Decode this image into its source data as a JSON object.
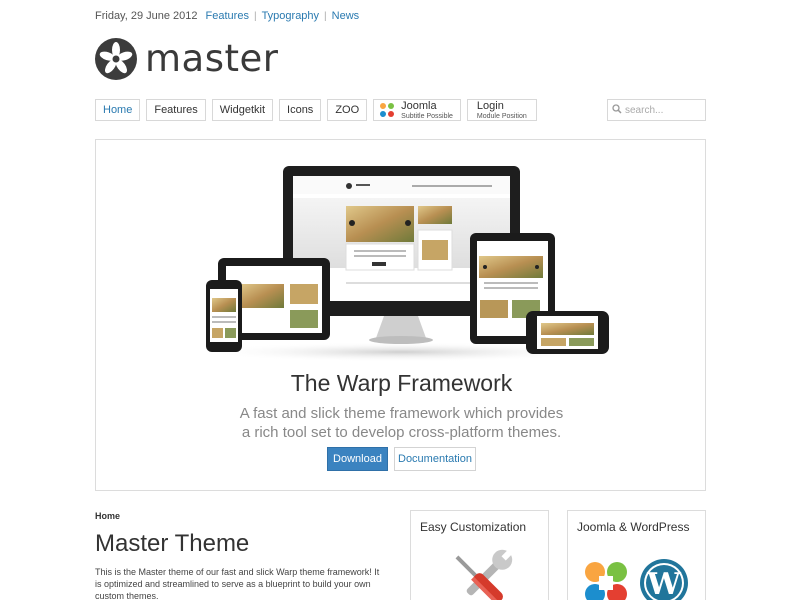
{
  "topbar": {
    "date": "Friday, 29 June 2012",
    "links": [
      "Features",
      "Typography",
      "News"
    ]
  },
  "logo": {
    "text": "master",
    "icon": "logo-flower-icon"
  },
  "nav": {
    "items": [
      {
        "label": "Home",
        "active": true
      },
      {
        "label": "Features"
      },
      {
        "label": "Widgetkit"
      },
      {
        "label": "Icons"
      },
      {
        "label": "ZOO"
      }
    ],
    "joomla": {
      "label": "Joomla",
      "subtitle": "Subtitle Possible",
      "icon": "joomla-icon"
    },
    "login": {
      "label": "Login",
      "subtitle": "Module Position"
    }
  },
  "search": {
    "placeholder": "search...",
    "icon": "search-icon"
  },
  "hero": {
    "title": "The Warp Framework",
    "subtitle_line1": "A fast and slick theme framework which provides",
    "subtitle_line2": "a rich tool set to develop cross-platform themes.",
    "primary_button": "Download",
    "secondary_button": "Documentation"
  },
  "content": {
    "breadcrumb": "Home",
    "title": "Master Theme",
    "intro_line1": "This is the Master theme of our fast and slick Warp theme framework! It",
    "intro_line2": "is optimized and streamlined to serve as a blueprint to build your own",
    "intro_line3": "custom themes."
  },
  "panels": [
    {
      "title": "Easy Customization",
      "icon": "tools-icon"
    },
    {
      "title": "Joomla & WordPress",
      "icon": "joomla-wordpress-icon"
    }
  ],
  "colors": {
    "accent": "#2a7ab0",
    "primary_button": "#3b83c0",
    "border": "#d8d8d8"
  }
}
